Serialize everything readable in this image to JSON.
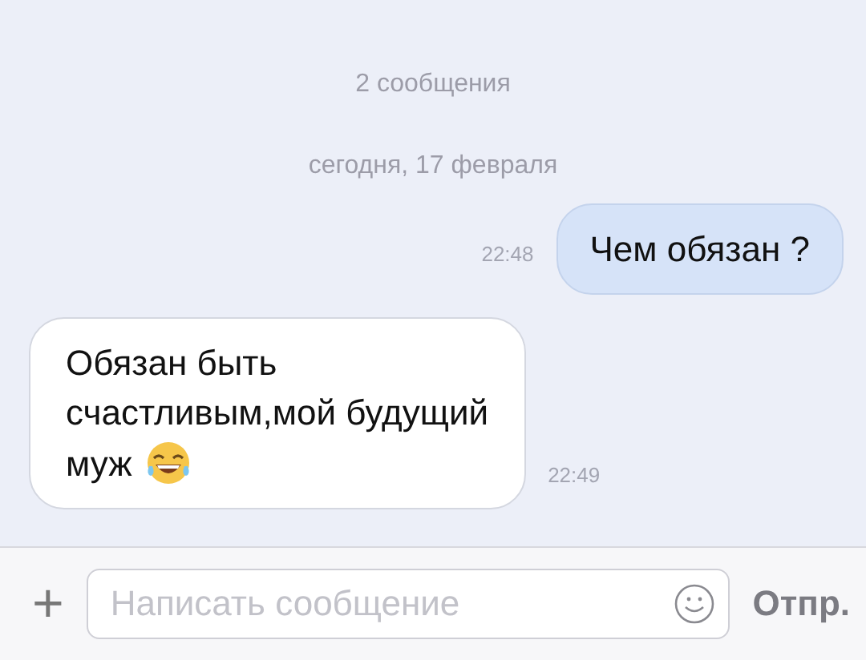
{
  "header": {
    "count": "2 сообщения",
    "date": "сегодня, 17 февраля"
  },
  "messages": [
    {
      "kind": "outgoing",
      "lines": [
        "Чем обязан ?"
      ],
      "time": "22:48",
      "emoji": false
    },
    {
      "kind": "incoming",
      "lines": [
        "Обязан быть",
        "счастливым,мой будущий",
        "муж"
      ],
      "time": "22:49",
      "emoji": true
    }
  ],
  "composer": {
    "add": "+",
    "placeholder": "Написать сообщение",
    "send": "Отпр."
  }
}
